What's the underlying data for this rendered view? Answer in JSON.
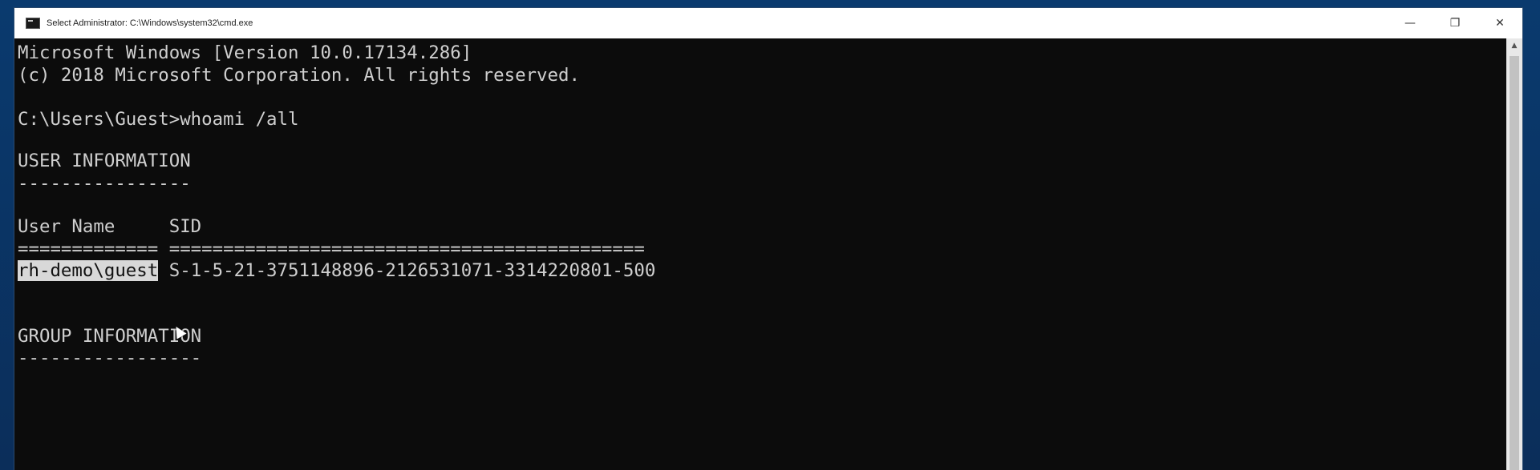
{
  "window": {
    "title": "Select Administrator: C:\\Windows\\system32\\cmd.exe",
    "controls": {
      "minimize": "—",
      "maximize": "❐",
      "close": "✕"
    }
  },
  "console": {
    "lines": [
      "Microsoft Windows [Version 10.0.17134.286]",
      "(c) 2018 Microsoft Corporation. All rights reserved.",
      "",
      "C:\\Users\\Guest>whoami /all",
      "",
      "USER INFORMATION",
      "----------------",
      "",
      "User Name     SID",
      "============= ============================================",
      "",
      "",
      "",
      "GROUP INFORMATION",
      "-----------------"
    ],
    "user_row": {
      "selected": "rh-demo\\guest",
      "rest": " S-1-5-21-3751148896-2126531071-3314220801-500"
    }
  }
}
